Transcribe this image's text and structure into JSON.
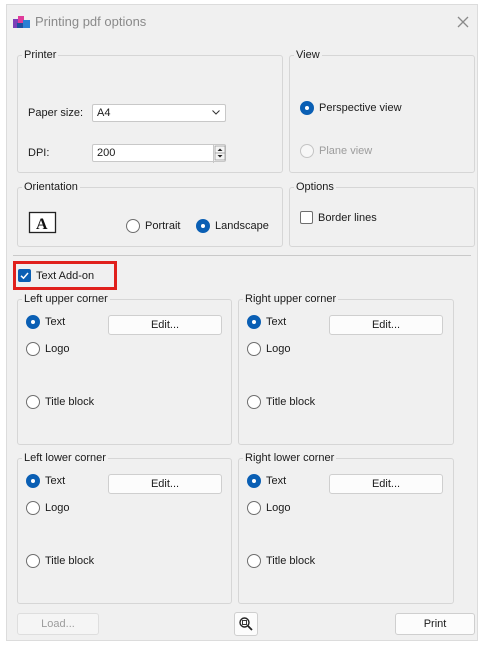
{
  "window": {
    "title": "Printing pdf options"
  },
  "printer": {
    "legend": "Printer",
    "paper_size_label": "Paper size:",
    "paper_size_value": "A4",
    "dpi_label": "DPI:",
    "dpi_value": "200"
  },
  "view": {
    "legend": "View",
    "perspective_label": "Perspective view",
    "plane_label": "Plane view",
    "selected": "perspective"
  },
  "orientation": {
    "legend": "Orientation",
    "icon_glyph": "A",
    "portrait_label": "Portrait",
    "landscape_label": "Landscape",
    "selected": "landscape"
  },
  "options": {
    "legend": "Options",
    "border_lines_label": "Border lines",
    "border_lines_checked": false
  },
  "text_addon": {
    "label": "Text Add-on",
    "checked": true
  },
  "corners": {
    "left_upper": {
      "legend": "Left upper corner",
      "text": "Text",
      "logo": "Logo",
      "title_block": "Title block",
      "edit": "Edit...",
      "selected": "text"
    },
    "right_upper": {
      "legend": "Right upper corner",
      "text": "Text",
      "logo": "Logo",
      "title_block": "Title block",
      "edit": "Edit...",
      "selected": "text"
    },
    "left_lower": {
      "legend": "Left lower corner",
      "text": "Text",
      "logo": "Logo",
      "title_block": "Title block",
      "edit": "Edit...",
      "selected": "text"
    },
    "right_lower": {
      "legend": "Right lower corner",
      "text": "Text",
      "logo": "Logo",
      "title_block": "Title block",
      "edit": "Edit...",
      "selected": "text"
    }
  },
  "footer": {
    "load_label": "Load...",
    "print_label": "Print",
    "preview_icon": "zoom-preview-icon"
  },
  "colors": {
    "accent": "#0a5fb4",
    "highlight": "#e0201c"
  }
}
